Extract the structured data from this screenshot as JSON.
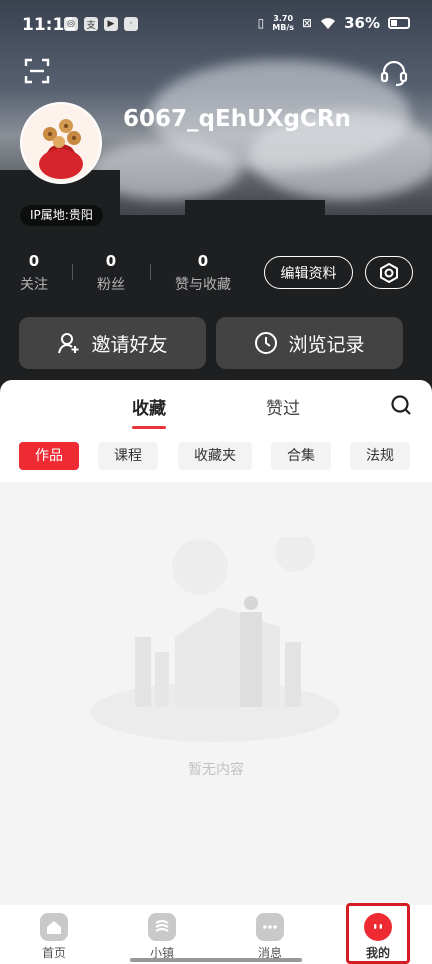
{
  "status_bar": {
    "time": "11:11",
    "network_speed": "3.70",
    "network_unit": "MB/s",
    "battery": "36%"
  },
  "profile": {
    "username": "6067_qEhUXgCRn",
    "ip_location": "IP属地:贵阳",
    "stats": [
      {
        "value": "0",
        "label": "关注"
      },
      {
        "value": "0",
        "label": "粉丝"
      },
      {
        "value": "0",
        "label": "赞与收藏"
      }
    ],
    "edit_label": "编辑资料",
    "invite_label": "邀请好友",
    "history_label": "浏览记录"
  },
  "tabs": [
    {
      "label": "收藏",
      "active": true
    },
    {
      "label": "赞过",
      "active": false
    }
  ],
  "filters": [
    {
      "label": "作品",
      "active": true
    },
    {
      "label": "课程",
      "active": false
    },
    {
      "label": "收藏夹",
      "active": false
    },
    {
      "label": "合集",
      "active": false
    },
    {
      "label": "法规",
      "active": false
    }
  ],
  "empty_text": "暂无内容",
  "nav": [
    {
      "label": "首页",
      "icon": "home-icon",
      "active": false
    },
    {
      "label": "小镇",
      "icon": "town-icon",
      "active": false
    },
    {
      "label": "消息",
      "icon": "message-icon",
      "active": false
    },
    {
      "label": "我的",
      "icon": "profile-icon",
      "active": true
    }
  ],
  "colors": {
    "accent": "#ee2a33",
    "highlight_box": "#d41c24"
  }
}
